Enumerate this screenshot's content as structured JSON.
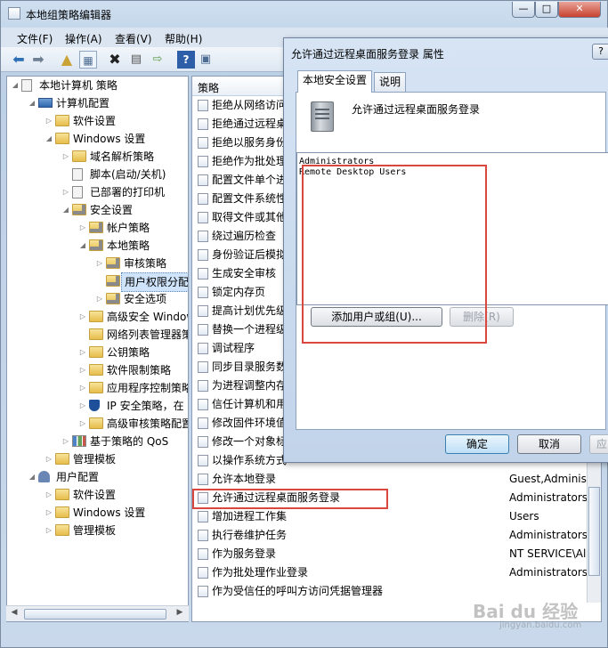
{
  "app": {
    "title": "本地组策略编辑器"
  },
  "menu": [
    "文件(F)",
    "操作(A)",
    "查看(V)",
    "帮助(H)"
  ],
  "tree": {
    "nodes": [
      {
        "label": "本地计算机 策略",
        "icon": "computer-policy-icon",
        "level": 0,
        "expanded": true
      },
      {
        "label": "计算机配置",
        "icon": "computer-icon",
        "level": 1,
        "expanded": true
      },
      {
        "label": "软件设置",
        "icon": "folder-icon",
        "level": 2,
        "expanded": false
      },
      {
        "label": "Windows 设置",
        "icon": "folder-icon",
        "level": 2,
        "expanded": true
      },
      {
        "label": "域名解析策略",
        "icon": "folder-icon",
        "level": 3,
        "expanded": false
      },
      {
        "label": "脚本(启动/关机)",
        "icon": "script-icon",
        "level": 3,
        "expanded": null
      },
      {
        "label": "已部署的打印机",
        "icon": "printer-icon",
        "level": 3,
        "expanded": false
      },
      {
        "label": "安全设置",
        "icon": "folder-lock-icon",
        "level": 3,
        "expanded": true
      },
      {
        "label": "帐户策略",
        "icon": "folder-lock-icon",
        "level": 4,
        "expanded": false
      },
      {
        "label": "本地策略",
        "icon": "folder-lock-icon",
        "level": 4,
        "expanded": true
      },
      {
        "label": "审核策略",
        "icon": "folder-lock-icon",
        "level": 5,
        "expanded": false
      },
      {
        "label": "用户权限分配",
        "icon": "folder-lock-icon",
        "level": 5,
        "expanded": null,
        "selected": true
      },
      {
        "label": "安全选项",
        "icon": "folder-lock-icon",
        "level": 5,
        "expanded": false
      },
      {
        "label": "高级安全 Windows",
        "icon": "folder-icon",
        "level": 4,
        "expanded": false
      },
      {
        "label": "网络列表管理器策略",
        "icon": "folder-icon",
        "level": 4,
        "expanded": null
      },
      {
        "label": "公钥策略",
        "icon": "folder-icon",
        "level": 4,
        "expanded": false
      },
      {
        "label": "软件限制策略",
        "icon": "folder-icon",
        "level": 4,
        "expanded": false
      },
      {
        "label": "应用程序控制策略",
        "icon": "folder-icon",
        "level": 4,
        "expanded": false
      },
      {
        "label": "IP 安全策略，在 本",
        "icon": "shield-icon",
        "level": 4,
        "expanded": false
      },
      {
        "label": "高级审核策略配置",
        "icon": "folder-icon",
        "level": 4,
        "expanded": false
      },
      {
        "label": "基于策略的 QoS",
        "icon": "chart-icon",
        "level": 3,
        "expanded": false
      },
      {
        "label": "管理模板",
        "icon": "folder-icon",
        "level": 2,
        "expanded": false
      },
      {
        "label": "用户配置",
        "icon": "user-icon",
        "level": 1,
        "expanded": true
      },
      {
        "label": "软件设置",
        "icon": "folder-icon",
        "level": 2,
        "expanded": false
      },
      {
        "label": "Windows 设置",
        "icon": "folder-icon",
        "level": 2,
        "expanded": false
      },
      {
        "label": "管理模板",
        "icon": "folder-icon",
        "level": 2,
        "expanded": false
      }
    ]
  },
  "list": {
    "header": "策略",
    "rows": [
      {
        "name": "拒绝从网络访问",
        "setting": ""
      },
      {
        "name": "拒绝通过远程桌",
        "setting": ""
      },
      {
        "name": "拒绝以服务身份",
        "setting": ""
      },
      {
        "name": "拒绝作为批处理",
        "setting": ""
      },
      {
        "name": "配置文件单个进",
        "setting": ""
      },
      {
        "name": "配置文件系统性",
        "setting": ""
      },
      {
        "name": "取得文件或其他",
        "setting": ""
      },
      {
        "name": "绕过遍历检查",
        "setting": ""
      },
      {
        "name": "身份验证后模拟",
        "setting": ""
      },
      {
        "name": "生成安全审核",
        "setting": ""
      },
      {
        "name": "锁定内存页",
        "setting": ""
      },
      {
        "name": "提高计划优先级",
        "setting": ""
      },
      {
        "name": "替换一个进程级",
        "setting": ""
      },
      {
        "name": "调试程序",
        "setting": ""
      },
      {
        "name": "同步目录服务数",
        "setting": ""
      },
      {
        "name": "为进程调整内存",
        "setting": ""
      },
      {
        "name": "信任计算机和用",
        "setting": ""
      },
      {
        "name": "修改固件环境值",
        "setting": ""
      },
      {
        "name": "修改一个对象标",
        "setting": ""
      },
      {
        "name": "以操作系统方式",
        "setting": ""
      },
      {
        "name": "允许本地登录",
        "setting": "Guest,Administ"
      },
      {
        "name": "允许通过远程桌面服务登录",
        "setting": "Administrators"
      },
      {
        "name": "增加进程工作集",
        "setting": "Users"
      },
      {
        "name": "执行卷维护任务",
        "setting": "Administrators"
      },
      {
        "name": "作为服务登录",
        "setting": "NT SERVICE\\All"
      },
      {
        "name": "作为批处理作业登录",
        "setting": "Administrators"
      },
      {
        "name": "作为受信任的呼叫方访问凭据管理器",
        "setting": ""
      }
    ]
  },
  "dialog": {
    "title": "允许通过远程桌面服务登录 属性",
    "help": "?",
    "tabs": [
      "本地安全设置",
      "说明"
    ],
    "policy_name": "允许通过远程桌面服务登录",
    "members": [
      "Administrators",
      "Remote Desktop Users"
    ],
    "add_button": "添加用户或组(U)...",
    "remove_button": "删除(R)",
    "ok": "确定",
    "cancel": "取消",
    "apply": "应"
  },
  "window_controls": {
    "min": "—",
    "max": "□",
    "close": "✕"
  },
  "watermark": {
    "brand": "Bai du 经验",
    "url": "jingyan.baidu.com"
  },
  "colors": {
    "highlight": "#d9473e",
    "selection": "#cfe3fa"
  }
}
